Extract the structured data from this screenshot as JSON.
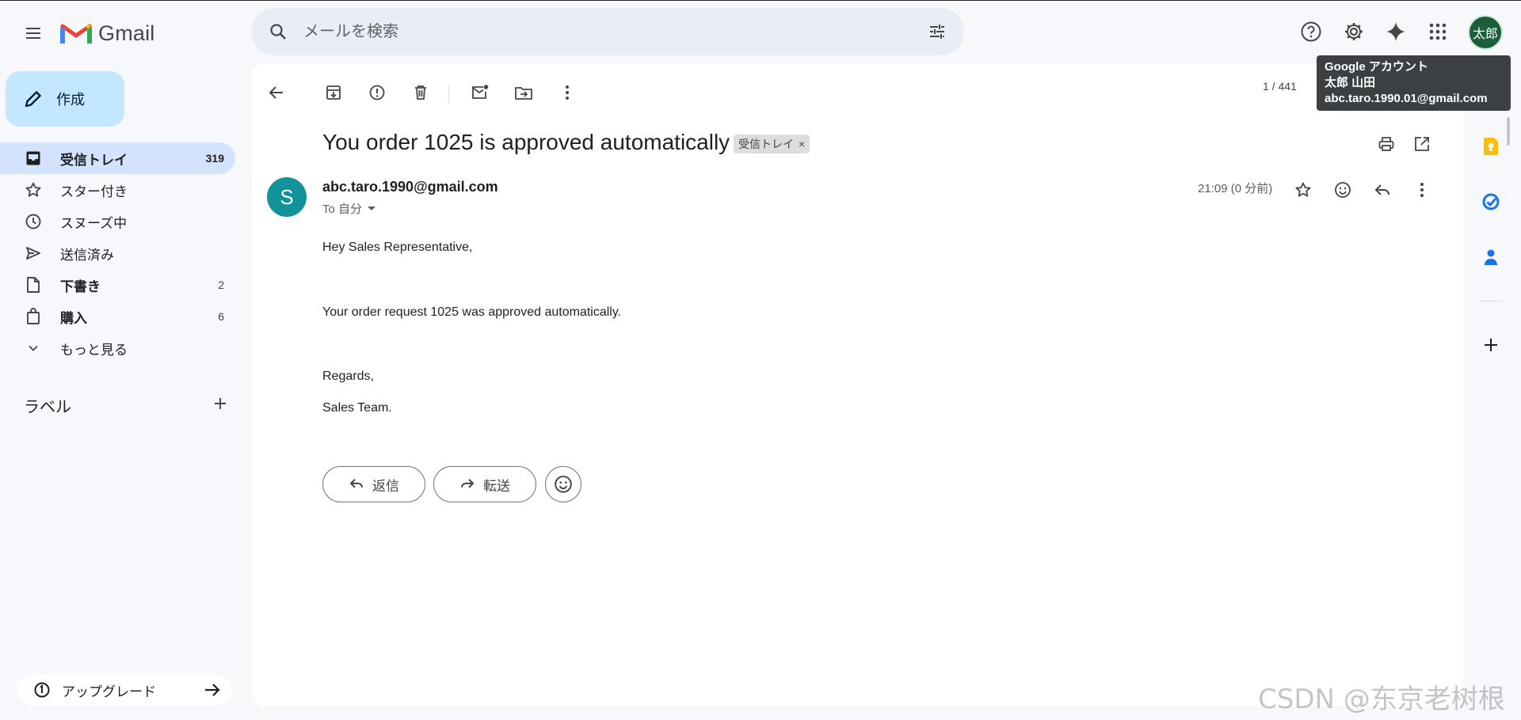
{
  "app": {
    "name": "Gmail"
  },
  "search": {
    "placeholder": "メールを検索"
  },
  "account": {
    "avatar_text": "太郎",
    "tooltip": {
      "title": "Google アカウント",
      "name": "太郎 山田",
      "email": "abc.taro.1990.01@gmail.com"
    }
  },
  "compose": {
    "label": "作成"
  },
  "nav": {
    "items": [
      {
        "label": "受信トレイ",
        "count": "319",
        "icon": "inbox-icon"
      },
      {
        "label": "スター付き",
        "count": "",
        "icon": "star-icon"
      },
      {
        "label": "スヌーズ中",
        "count": "",
        "icon": "clock-icon"
      },
      {
        "label": "送信済み",
        "count": "",
        "icon": "send-icon"
      },
      {
        "label": "下書き",
        "count": "2",
        "icon": "draft-icon"
      },
      {
        "label": "購入",
        "count": "6",
        "icon": "shopping-bag-icon"
      },
      {
        "label": "もっと見る",
        "count": "",
        "icon": "chevron-down-icon"
      }
    ],
    "labels_heading": "ラベル",
    "upgrade": "アップグレード"
  },
  "toolbar": {
    "pager": "1 / 441"
  },
  "message": {
    "subject": "You order 1025 is approved automatically",
    "label_chip": "受信トレイ",
    "label_chip_close": "×",
    "sender_initial": "S",
    "sender": "abc.taro.1990@gmail.com",
    "to": "To 自分",
    "time": "21:09 (0 分前)",
    "body": [
      "Hey Sales Representative,",
      "Your order request 1025 was approved automatically.",
      "Regards,",
      "Sales Team."
    ],
    "reply_label": "返信",
    "forward_label": "転送"
  },
  "watermark": "CSDN @东京老树根",
  "colors": {
    "accent": "#0b57d0",
    "compose_bg": "#c2e7ff",
    "active_nav": "#d3e3fd",
    "sender_avatar": "#12939a"
  }
}
